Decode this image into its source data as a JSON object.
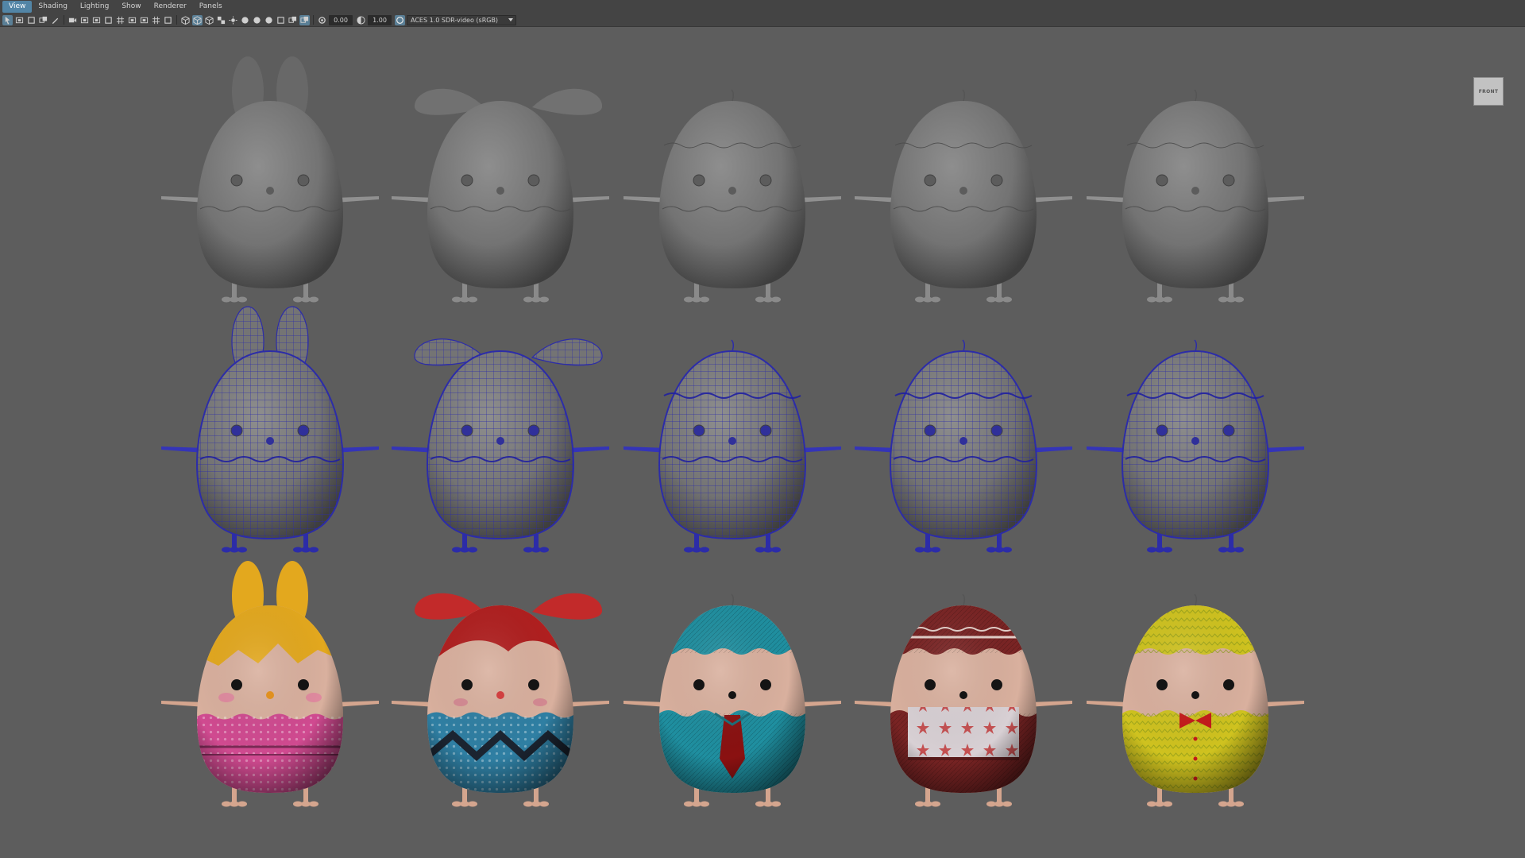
{
  "menu": [
    {
      "label": "View",
      "active": true
    },
    {
      "label": "Shading"
    },
    {
      "label": "Lighting"
    },
    {
      "label": "Show"
    },
    {
      "label": "Renderer"
    },
    {
      "label": "Panels"
    }
  ],
  "toolbar": {
    "exposure_value": "0.00",
    "gamma_value": "1.00",
    "color_space": "ACES 1.0 SDR-video (sRGB)"
  },
  "view_cube": {
    "label": "FRONT"
  },
  "viewport": {
    "background_color": "#5d5d5d",
    "rows": [
      {
        "name": "smooth-shaded",
        "shading": "solid gray"
      },
      {
        "name": "wireframe-on-shaded",
        "shading": "gray with blue wireframe"
      },
      {
        "name": "textured",
        "shading": "textured"
      }
    ],
    "characters": [
      {
        "name": "bunny",
        "accessory": "bunny ears",
        "color": "#e3a81e",
        "pattern_color": "#d04a90"
      },
      {
        "name": "bow-girl",
        "accessory": "red bow",
        "color": "#c22a2a",
        "pattern_color": "#2f7fa3"
      },
      {
        "name": "tie-chick",
        "accessory": "necktie",
        "color": "#1f8fa0",
        "pattern_color": "#8a1111"
      },
      {
        "name": "apron-chick",
        "accessory": "apron",
        "color": "#7a2424",
        "pattern_color": "#d8d0d4"
      },
      {
        "name": "bowtie-chick",
        "accessory": "bow tie",
        "color": "#cfc21f",
        "pattern_color": "#c41919"
      }
    ]
  }
}
